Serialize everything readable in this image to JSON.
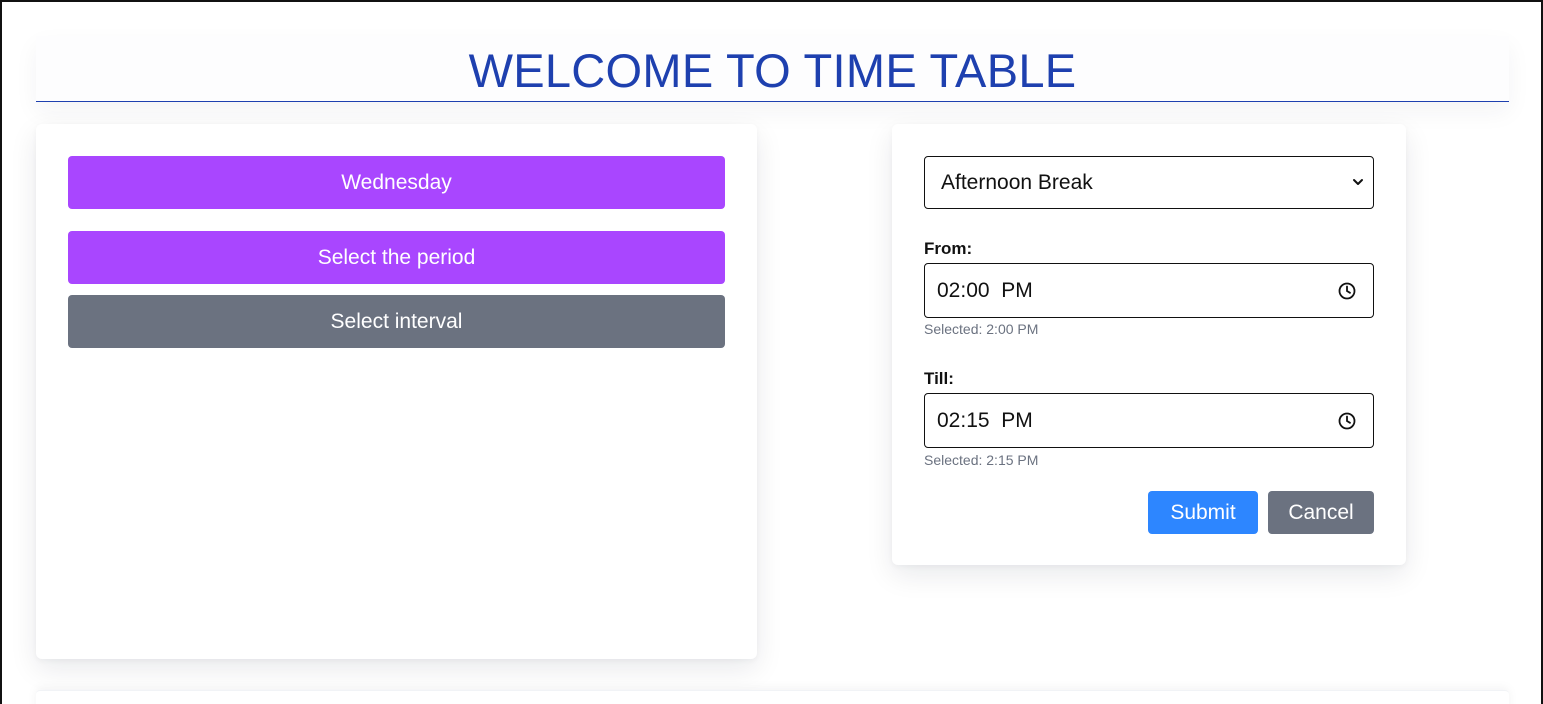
{
  "header": {
    "title": "WELCOME TO TIME TABLE"
  },
  "left_panel": {
    "day_button": "Wednesday",
    "period_button": "Select the period",
    "interval_button": "Select interval"
  },
  "right_panel": {
    "interval_select": {
      "value": "Afternoon Break"
    },
    "from": {
      "label": "From:",
      "value": "02:00  PM",
      "helper": "Selected: 2:00 PM"
    },
    "till": {
      "label": "Till:",
      "value": "02:15  PM",
      "helper": "Selected: 2:15 PM"
    },
    "submit_label": "Submit",
    "cancel_label": "Cancel"
  },
  "colors": {
    "title": "#1e40af",
    "purple_button": "#a946ff",
    "gray_button": "#6b7280",
    "submit_button": "#2d86ff"
  },
  "icons": {
    "select_arrow": "chevron-down-icon",
    "time_picker": "clock-icon"
  }
}
